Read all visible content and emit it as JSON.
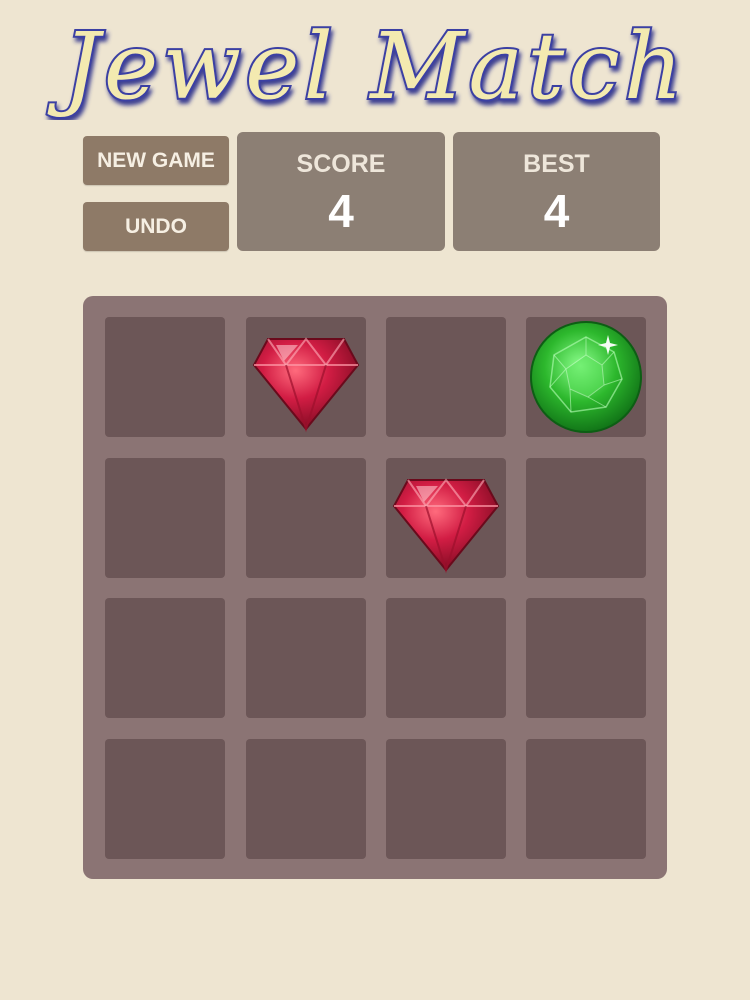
{
  "title": "Jewel Match",
  "buttons": {
    "new_game": "NEW GAME",
    "undo": "UNDO"
  },
  "score": {
    "label": "SCORE",
    "value": "4"
  },
  "best": {
    "label": "BEST",
    "value": "4"
  },
  "colors": {
    "background": "#eee5d1",
    "button": "#8e7a67",
    "score_box": "#8c7f74",
    "board": "#8b7474",
    "cell": "#6c5657",
    "title_fill": "#f3eab0",
    "title_outline": "#3b3fa3",
    "ruby": "#c4173a",
    "emerald": "#2fb52f"
  },
  "board": {
    "rows": 4,
    "cols": 4,
    "tiles": [
      [
        null,
        "ruby",
        null,
        "emerald"
      ],
      [
        null,
        null,
        "ruby",
        null
      ],
      [
        null,
        null,
        null,
        null
      ],
      [
        null,
        null,
        null,
        null
      ]
    ]
  }
}
